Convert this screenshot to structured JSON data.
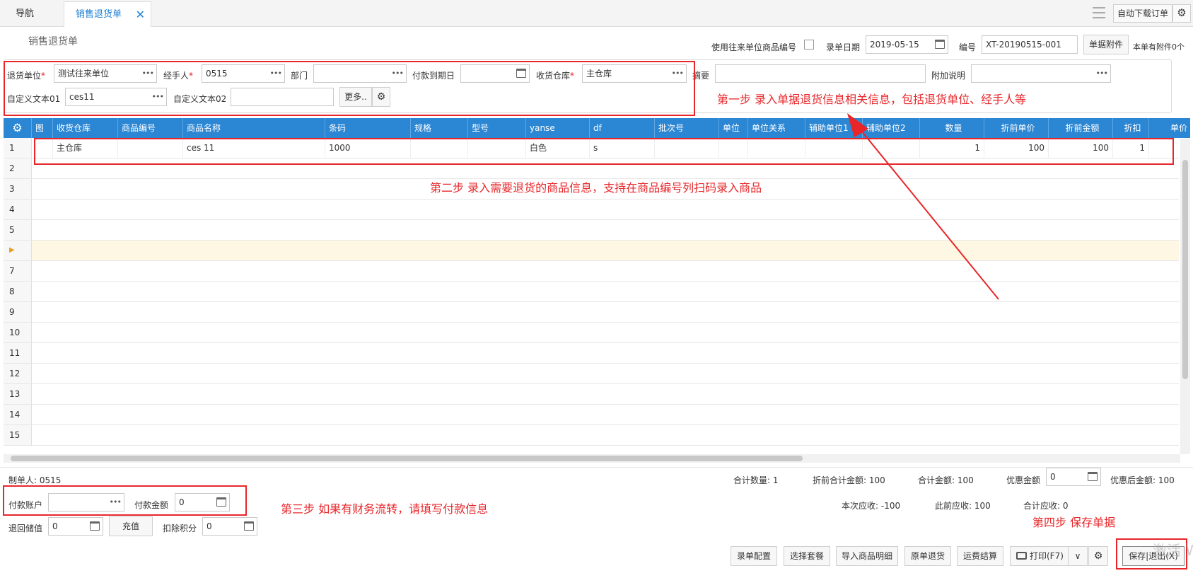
{
  "tabs": {
    "nav": "导航",
    "active": "销售退货单"
  },
  "toolbar_right": {
    "auto_download": "自动下载订单"
  },
  "page_title": "销售退货单",
  "header": {
    "use_partner_code": "使用往来单位商品编号",
    "date_label": "录单日期",
    "date_value": "2019-05-15",
    "no_label": "编号",
    "no_value": "XT-20190515-001",
    "attach_btn": "单据附件",
    "attach_info": "本单有附件0个"
  },
  "form": {
    "return_unit_label": "退货单位",
    "return_unit_value": "测试往来单位",
    "handler_label": "经手人",
    "handler_value": "0515",
    "dept_label": "部门",
    "dept_value": "",
    "pay_due_label": "付款到期日",
    "pay_due_value": "",
    "warehouse_label": "收货仓库",
    "warehouse_value": "主仓库",
    "summary_label": "摘要",
    "summary_value": "",
    "extra_label": "附加说明",
    "extra_value": "",
    "custom1_label": "自定义文本01",
    "custom1_value": "ces11",
    "custom2_label": "自定义文本02",
    "custom2_value": "",
    "more_btn": "更多.."
  },
  "annotations": {
    "step1": "第一步  录入单据退货信息相关信息，包括退货单位、经手人等",
    "step2": "第二步    录入需要退货的商品信息，支持在商品编号列扫码录入商品",
    "step3": "第三步  如果有财务流转，请填写付款信息",
    "step4": "第四步    保存单据"
  },
  "table": {
    "columns": [
      "图",
      "收货仓库",
      "商品编号",
      "商品名称",
      "条码",
      "规格",
      "型号",
      "yanse",
      "df",
      "批次号",
      "单位",
      "单位关系",
      "辅助单位1",
      "辅助单位2",
      "数量",
      "折前单价",
      "折前金额",
      "折扣",
      "单价"
    ],
    "row1": {
      "num": "1",
      "warehouse": "主仓库",
      "code": "",
      "name": "ces 11",
      "barcode": "1000",
      "spec": "",
      "model": "",
      "yanse": "白色",
      "df": "s",
      "batch": "",
      "unit": "",
      "unit_rel": "",
      "aux1": "",
      "aux2": "",
      "qty": "1",
      "pre_price": "100",
      "pre_amount": "100",
      "discount": "1"
    },
    "row_numbers": [
      "2",
      "3",
      "4",
      "5",
      "▶",
      "7",
      "8",
      "9",
      "10",
      "11",
      "12",
      "13",
      "14",
      "15"
    ]
  },
  "footer": {
    "maker_label": "制单人:",
    "maker_value": "0515",
    "total_qty_label": "合计数量:",
    "total_qty_value": "1",
    "pre_total_label": "折前合计金额:",
    "pre_total_value": "100",
    "total_amount_label": "合计金额:",
    "total_amount_value": "100",
    "discount_amount_label": "优惠金额",
    "discount_amount_value": "0",
    "after_discount_label": "优惠后金额:",
    "after_discount_value": "100",
    "receivable_label": "本次应收:",
    "receivable_value": "-100",
    "prev_receivable_label": "此前应收:",
    "prev_receivable_value": "100",
    "total_receivable_label": "合计应收:",
    "total_receivable_value": "0",
    "pay_account_label": "付款账户",
    "pay_account_value": "",
    "pay_amount_label": "付款金额",
    "pay_amount_value": "0",
    "stored_value_label": "退回储值",
    "stored_value_value": "0",
    "recharge_btn": "充值",
    "points_label": "扣除积分",
    "points_value": "0"
  },
  "bottom_buttons": [
    "录单配置",
    "选择套餐",
    "导入商品明细",
    "原单退货",
    "运费结算"
  ],
  "print_btn": "打印(F7)",
  "save_btn": "保存|退出(X)",
  "watermark": "激活 W"
}
